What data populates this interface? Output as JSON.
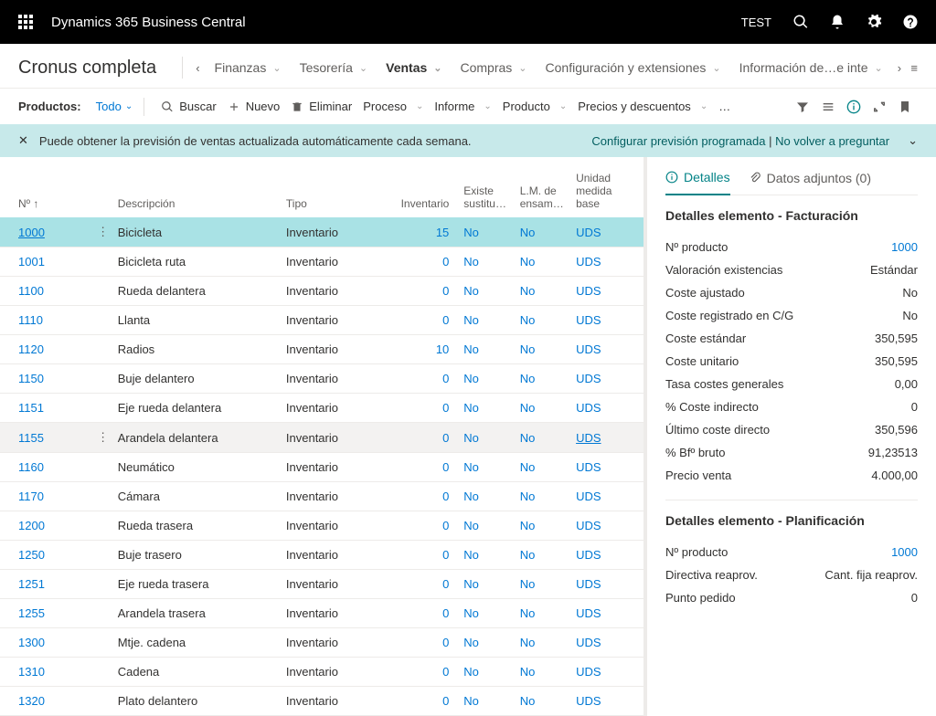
{
  "header": {
    "product": "Dynamics 365 Business Central",
    "env": "TEST"
  },
  "nav": {
    "company": "Cronus completa",
    "items": [
      "Finanzas",
      "Tesorería",
      "Ventas",
      "Compras",
      "Configuración y extensiones",
      "Información de…e inte"
    ],
    "active_index": 2
  },
  "actions": {
    "entity_label": "Productos:",
    "view": "Todo",
    "search": "Buscar",
    "new": "Nuevo",
    "delete": "Eliminar",
    "process": "Proceso",
    "report": "Informe",
    "product": "Producto",
    "prices": "Precios y descuentos",
    "more": "…"
  },
  "notif": {
    "text": "Puede obtener la previsión de ventas actualizada automáticamente cada semana.",
    "link1": "Configurar previsión programada",
    "sep": " | ",
    "link2": "No volver a preguntar"
  },
  "grid": {
    "columns": [
      "Nº ↑",
      "",
      "Descripción",
      "Tipo",
      "Inventario",
      "Existe sustitu…",
      "L.M. de ensam…",
      "Unidad medida base"
    ],
    "rows": [
      {
        "no": "1000",
        "desc": "Bicicleta",
        "type": "Inventario",
        "inv": "15",
        "sub": "No",
        "bom": "No",
        "uom": "UDS"
      },
      {
        "no": "1001",
        "desc": "Bicicleta ruta",
        "type": "Inventario",
        "inv": "0",
        "sub": "No",
        "bom": "No",
        "uom": "UDS"
      },
      {
        "no": "1100",
        "desc": "Rueda delantera",
        "type": "Inventario",
        "inv": "0",
        "sub": "No",
        "bom": "No",
        "uom": "UDS"
      },
      {
        "no": "1110",
        "desc": "Llanta",
        "type": "Inventario",
        "inv": "0",
        "sub": "No",
        "bom": "No",
        "uom": "UDS"
      },
      {
        "no": "1120",
        "desc": "Radios",
        "type": "Inventario",
        "inv": "10",
        "sub": "No",
        "bom": "No",
        "uom": "UDS"
      },
      {
        "no": "1150",
        "desc": "Buje delantero",
        "type": "Inventario",
        "inv": "0",
        "sub": "No",
        "bom": "No",
        "uom": "UDS"
      },
      {
        "no": "1151",
        "desc": "Eje rueda delantera",
        "type": "Inventario",
        "inv": "0",
        "sub": "No",
        "bom": "No",
        "uom": "UDS"
      },
      {
        "no": "1155",
        "desc": "Arandela delantera",
        "type": "Inventario",
        "inv": "0",
        "sub": "No",
        "bom": "No",
        "uom": "UDS"
      },
      {
        "no": "1160",
        "desc": "Neumático",
        "type": "Inventario",
        "inv": "0",
        "sub": "No",
        "bom": "No",
        "uom": "UDS"
      },
      {
        "no": "1170",
        "desc": "Cámara",
        "type": "Inventario",
        "inv": "0",
        "sub": "No",
        "bom": "No",
        "uom": "UDS"
      },
      {
        "no": "1200",
        "desc": "Rueda trasera",
        "type": "Inventario",
        "inv": "0",
        "sub": "No",
        "bom": "No",
        "uom": "UDS"
      },
      {
        "no": "1250",
        "desc": "Buje trasero",
        "type": "Inventario",
        "inv": "0",
        "sub": "No",
        "bom": "No",
        "uom": "UDS"
      },
      {
        "no": "1251",
        "desc": "Eje rueda trasera",
        "type": "Inventario",
        "inv": "0",
        "sub": "No",
        "bom": "No",
        "uom": "UDS"
      },
      {
        "no": "1255",
        "desc": "Arandela trasera",
        "type": "Inventario",
        "inv": "0",
        "sub": "No",
        "bom": "No",
        "uom": "UDS"
      },
      {
        "no": "1300",
        "desc": "Mtje. cadena",
        "type": "Inventario",
        "inv": "0",
        "sub": "No",
        "bom": "No",
        "uom": "UDS"
      },
      {
        "no": "1310",
        "desc": "Cadena",
        "type": "Inventario",
        "inv": "0",
        "sub": "No",
        "bom": "No",
        "uom": "UDS"
      },
      {
        "no": "1320",
        "desc": "Plato delantero",
        "type": "Inventario",
        "inv": "0",
        "sub": "No",
        "bom": "No",
        "uom": "UDS"
      }
    ],
    "selected_index": 0,
    "hover_index": 7
  },
  "factbox": {
    "tab_details": "Detalles",
    "tab_attach": "Datos adjuntos (0)",
    "section1_title": "Detalles elemento - Facturación",
    "section1": [
      {
        "lbl": "Nº producto",
        "val": "1000",
        "link": true
      },
      {
        "lbl": "Valoración existencias",
        "val": "Estándar"
      },
      {
        "lbl": "Coste ajustado",
        "val": "No"
      },
      {
        "lbl": "Coste registrado en C/G",
        "val": "No"
      },
      {
        "lbl": "Coste estándar",
        "val": "350,595"
      },
      {
        "lbl": "Coste unitario",
        "val": "350,595"
      },
      {
        "lbl": "Tasa costes generales",
        "val": "0,00"
      },
      {
        "lbl": "% Coste indirecto",
        "val": "0"
      },
      {
        "lbl": "Último coste directo",
        "val": "350,596"
      },
      {
        "lbl": "% Bfº bruto",
        "val": "91,23513"
      },
      {
        "lbl": "Precio venta",
        "val": "4.000,00"
      }
    ],
    "section2_title": "Detalles elemento - Planificación",
    "section2": [
      {
        "lbl": "Nº producto",
        "val": "1000",
        "link": true
      },
      {
        "lbl": "Directiva reaprov.",
        "val": "Cant. fija reaprov."
      },
      {
        "lbl": "Punto pedido",
        "val": "0"
      }
    ]
  }
}
